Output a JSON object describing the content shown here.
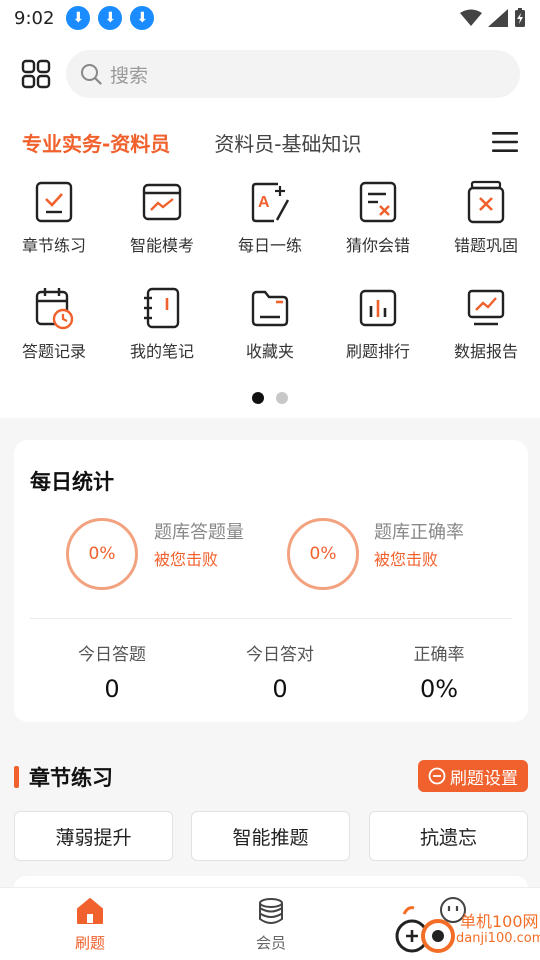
{
  "status_bar": {
    "time": "9:02",
    "download_icon_count": 3
  },
  "search": {
    "placeholder": "搜索"
  },
  "tabs": [
    {
      "label": "专业实务-资料员",
      "active": true
    },
    {
      "label": "资料员-基础知识",
      "active": false
    }
  ],
  "features": [
    {
      "label": "章节练习",
      "icon": "chapter-check-icon"
    },
    {
      "label": "智能模考",
      "icon": "chart-window-icon"
    },
    {
      "label": "每日一练",
      "icon": "daily-pencil-icon"
    },
    {
      "label": "猜你会错",
      "icon": "doc-x-icon"
    },
    {
      "label": "错题巩固",
      "icon": "stack-x-icon"
    },
    {
      "label": "答题记录",
      "icon": "calendar-clock-icon"
    },
    {
      "label": "我的笔记",
      "icon": "notebook-icon"
    },
    {
      "label": "收藏夹",
      "icon": "folder-icon"
    },
    {
      "label": "刷题排行",
      "icon": "bar-chart-icon"
    },
    {
      "label": "数据报告",
      "icon": "monitor-chart-icon"
    }
  ],
  "pagination": {
    "current": 1,
    "total": 2
  },
  "daily_stats": {
    "title": "每日统计",
    "rings": [
      {
        "value": "0%",
        "label": "题库答题量",
        "sub": "被您击败"
      },
      {
        "value": "0%",
        "label": "题库正确率",
        "sub": "被您击败"
      }
    ],
    "stats": [
      {
        "title": "今日答题",
        "value": "0"
      },
      {
        "title": "今日答对",
        "value": "0"
      },
      {
        "title": "正确率",
        "value": "0%"
      }
    ]
  },
  "chapter": {
    "title": "章节练习",
    "settings_label": "刷题设置",
    "buttons": [
      "薄弱提升",
      "智能推题",
      "抗遗忘"
    ]
  },
  "bottom_nav": [
    {
      "label": "刷题",
      "active": true
    },
    {
      "label": "会员",
      "active": false
    }
  ],
  "watermark": {
    "text": "单机100网",
    "sub": "danji100.com"
  },
  "colors": {
    "accent": "#f0612d",
    "ring": "#f3a27f",
    "download_badge": "#1a8cff"
  }
}
